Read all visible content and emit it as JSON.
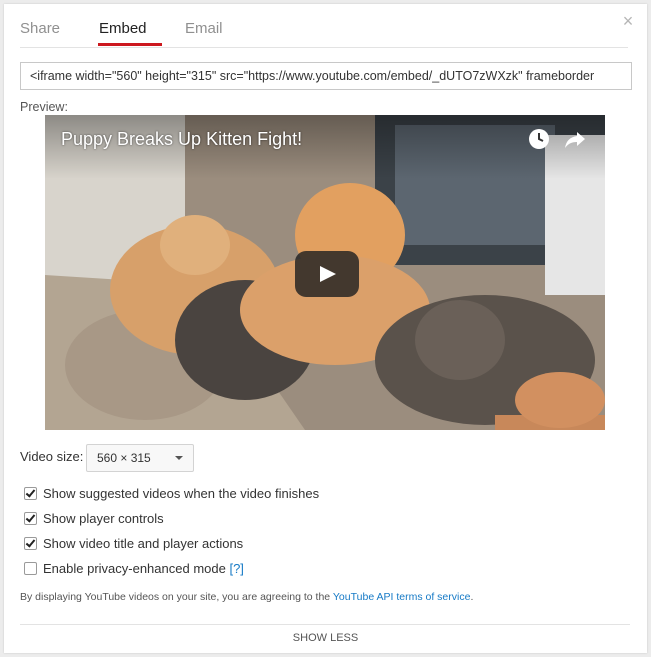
{
  "dialog": {
    "close_label": "×",
    "tabs": [
      {
        "label": "Share",
        "active": false
      },
      {
        "label": "Embed",
        "active": true
      },
      {
        "label": "Email",
        "active": false
      }
    ],
    "accent_color": "#cc181e"
  },
  "embed": {
    "code": "<iframe width=\"560\" height=\"315\" src=\"https://www.youtube.com/embed/_dUTO7zWXzk\" frameborder",
    "preview_label": "Preview:"
  },
  "player": {
    "video_title": "Puppy Breaks Up Kitten Fight!",
    "icons": [
      "clock-icon",
      "share-icon",
      "play-icon"
    ]
  },
  "video_size": {
    "label": "Video size:",
    "selected": "560 × 315"
  },
  "options": [
    {
      "label": "Show suggested videos when the video finishes",
      "checked": true
    },
    {
      "label": "Show player controls",
      "checked": true
    },
    {
      "label": "Show video title and player actions",
      "checked": true
    },
    {
      "label": "Enable privacy-enhanced mode",
      "checked": false,
      "help": "[?]"
    }
  ],
  "terms": {
    "prefix": "By displaying YouTube videos on your site, you are agreeing to the",
    "link": "YouTube API terms of service",
    "suffix": "."
  },
  "footer": {
    "show_less": "SHOW LESS"
  }
}
